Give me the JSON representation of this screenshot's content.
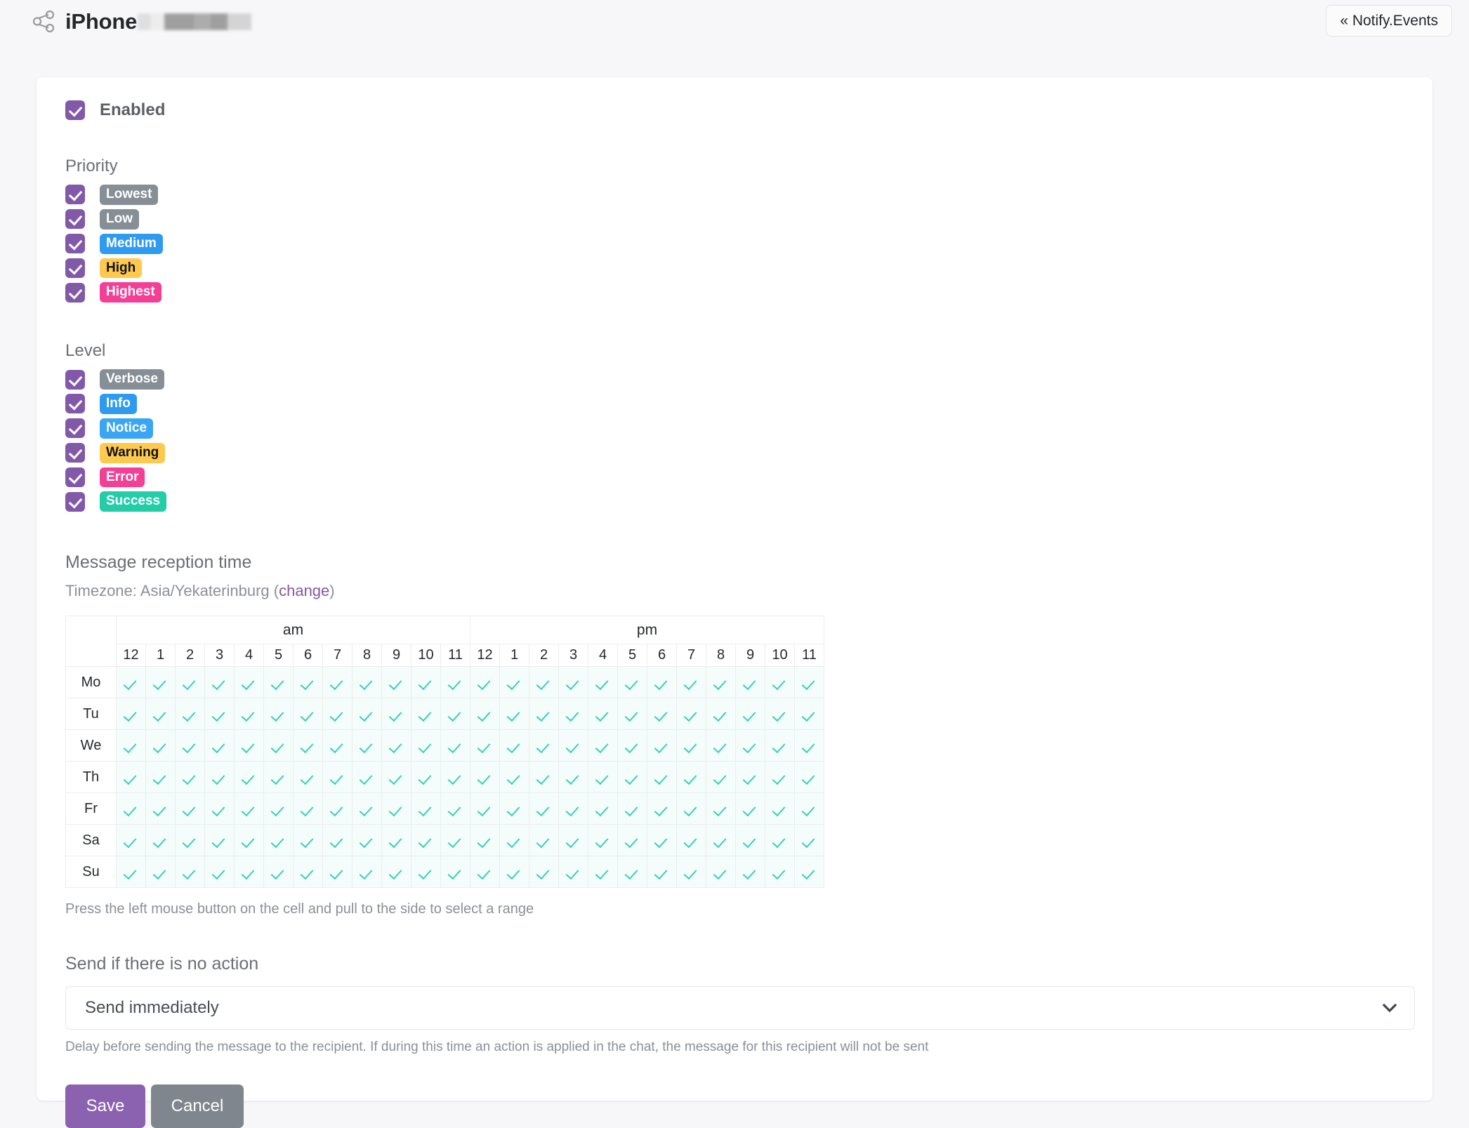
{
  "header": {
    "icon": "share-nodes-icon",
    "title": "iPhone",
    "title_redacted": true,
    "notify_button": "« Notify.Events"
  },
  "form": {
    "enabled": {
      "label": "Enabled",
      "checked": true
    },
    "priority": {
      "title": "Priority",
      "options": [
        {
          "label": "Lowest",
          "checked": true,
          "color": "#868e96",
          "text_color": "#ffffff"
        },
        {
          "label": "Low",
          "checked": true,
          "color": "#868e96",
          "text_color": "#ffffff"
        },
        {
          "label": "Medium",
          "checked": true,
          "color": "#2f9bf0",
          "text_color": "#ffffff"
        },
        {
          "label": "High",
          "checked": true,
          "color": "#ffc94d",
          "text_color": "#101214"
        },
        {
          "label": "Highest",
          "checked": true,
          "color": "#f43f96",
          "text_color": "#ffffff"
        }
      ]
    },
    "level": {
      "title": "Level",
      "options": [
        {
          "label": "Verbose",
          "checked": true,
          "color": "#868e96",
          "text_color": "#ffffff"
        },
        {
          "label": "Info",
          "checked": true,
          "color": "#2f9bf0",
          "text_color": "#ffffff"
        },
        {
          "label": "Notice",
          "checked": true,
          "color": "#3aa5f5",
          "text_color": "#ffffff"
        },
        {
          "label": "Warning",
          "checked": true,
          "color": "#ffc94d",
          "text_color": "#101214"
        },
        {
          "label": "Error",
          "checked": true,
          "color": "#f43f96",
          "text_color": "#ffffff"
        },
        {
          "label": "Success",
          "checked": true,
          "color": "#22cda8",
          "text_color": "#ffffff"
        }
      ]
    },
    "reception_time": {
      "title": "Message reception time",
      "timezone_prefix": "Timezone: Asia/Yekaterinburg (",
      "timezone_name": "Asia/Yekaterinburg",
      "change_link": "change",
      "timezone_suffix": ")",
      "am_label": "am",
      "pm_label": "pm",
      "hours_am": [
        "12",
        "1",
        "2",
        "3",
        "4",
        "5",
        "6",
        "7",
        "8",
        "9",
        "10",
        "11"
      ],
      "hours_pm": [
        "12",
        "1",
        "2",
        "3",
        "4",
        "5",
        "6",
        "7",
        "8",
        "9",
        "10",
        "11"
      ],
      "days": [
        "Mo",
        "Tu",
        "We",
        "Th",
        "Fr",
        "Sa",
        "Su"
      ],
      "all_cells_checked": true,
      "cell_check_color": "#36d0b4",
      "cell_bg_color": "#f4fdfb",
      "hint": "Press the left mouse button on the cell and pull to the side to select a range"
    },
    "send_if_no_action": {
      "title": "Send if there is no action",
      "selected": "Send immediately",
      "hint": "Delay before sending the message to the recipient. If during this time an action is applied in the chat, the message for this recipient will not be sent"
    },
    "buttons": {
      "save": "Save",
      "cancel": "Cancel"
    }
  },
  "theme": {
    "accent": "#8159a8",
    "save_button": "#8a62b0",
    "cancel_button": "#7f868d",
    "link": "#8159a8"
  }
}
